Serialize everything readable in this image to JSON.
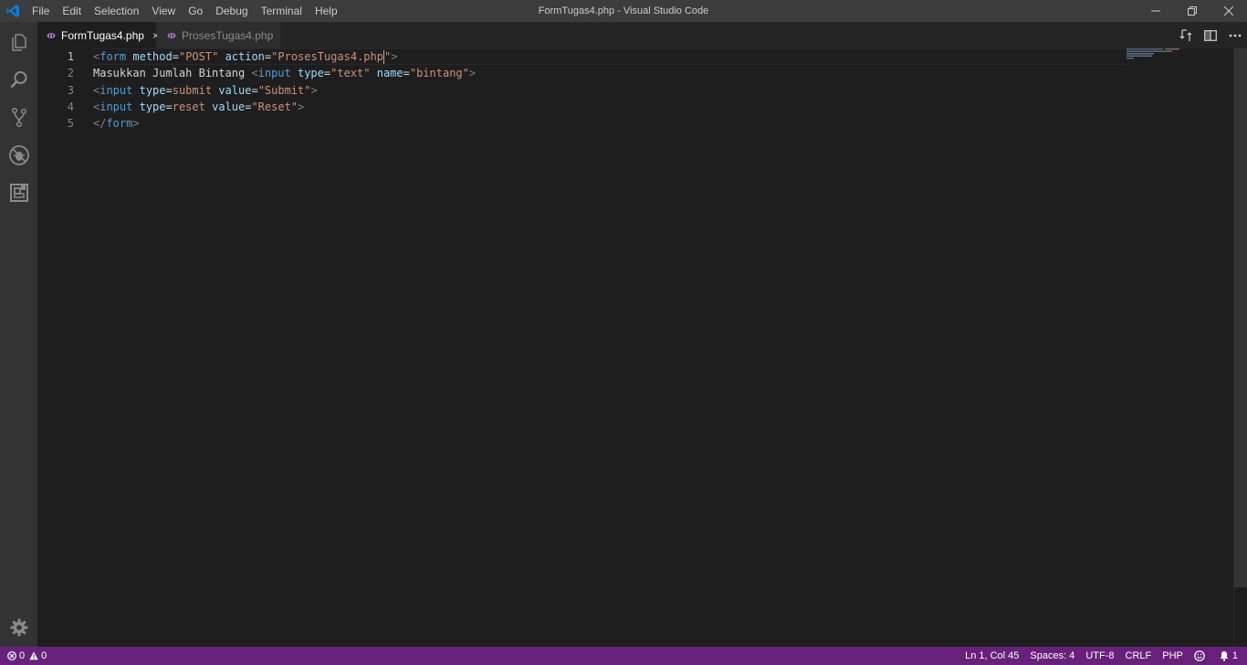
{
  "window": {
    "title": "FormTugas4.php - Visual Studio Code"
  },
  "menu": [
    "File",
    "Edit",
    "Selection",
    "View",
    "Go",
    "Debug",
    "Terminal",
    "Help"
  ],
  "activity_bar": {
    "icons": [
      "explorer-icon",
      "search-icon",
      "source-control-icon",
      "debug-icon",
      "extensions-icon",
      "gear-icon"
    ]
  },
  "tabs": [
    {
      "label": "FormTugas4.php",
      "active": true,
      "close": "×"
    },
    {
      "label": "ProsesTugas4.php",
      "active": false
    }
  ],
  "editor": {
    "line_numbers": [
      "1",
      "2",
      "3",
      "4",
      "5"
    ],
    "lines": [
      [
        {
          "t": "punc",
          "v": "<"
        },
        {
          "t": "tag",
          "v": "form"
        },
        {
          "t": "text",
          "v": " "
        },
        {
          "t": "attr",
          "v": "method"
        },
        {
          "t": "text",
          "v": "="
        },
        {
          "t": "str",
          "v": "\"POST\""
        },
        {
          "t": "text",
          "v": " "
        },
        {
          "t": "attr",
          "v": "action"
        },
        {
          "t": "text",
          "v": "="
        },
        {
          "t": "str",
          "v": "\"ProsesTugas4.php"
        },
        {
          "t": "cursor",
          "v": ""
        },
        {
          "t": "str",
          "v": "\""
        },
        {
          "t": "punc",
          "v": ">"
        }
      ],
      [
        {
          "t": "text",
          "v": "Masukkan Jumlah Bintang "
        },
        {
          "t": "punc",
          "v": "<"
        },
        {
          "t": "tag",
          "v": "input"
        },
        {
          "t": "text",
          "v": " "
        },
        {
          "t": "attr",
          "v": "type"
        },
        {
          "t": "text",
          "v": "="
        },
        {
          "t": "str",
          "v": "\"text\""
        },
        {
          "t": "text",
          "v": " "
        },
        {
          "t": "attr",
          "v": "name"
        },
        {
          "t": "text",
          "v": "="
        },
        {
          "t": "str",
          "v": "\"bintang\""
        },
        {
          "t": "punc",
          "v": ">"
        }
      ],
      [
        {
          "t": "punc",
          "v": "<"
        },
        {
          "t": "tag",
          "v": "input"
        },
        {
          "t": "text",
          "v": " "
        },
        {
          "t": "attr",
          "v": "type"
        },
        {
          "t": "text",
          "v": "="
        },
        {
          "t": "str",
          "v": "submit"
        },
        {
          "t": "text",
          "v": " "
        },
        {
          "t": "attr",
          "v": "value"
        },
        {
          "t": "text",
          "v": "="
        },
        {
          "t": "str",
          "v": "\"Submit\""
        },
        {
          "t": "punc",
          "v": ">"
        }
      ],
      [
        {
          "t": "punc",
          "v": "<"
        },
        {
          "t": "tag",
          "v": "input"
        },
        {
          "t": "text",
          "v": " "
        },
        {
          "t": "attr",
          "v": "type"
        },
        {
          "t": "text",
          "v": "="
        },
        {
          "t": "str",
          "v": "reset"
        },
        {
          "t": "text",
          "v": " "
        },
        {
          "t": "attr",
          "v": "value"
        },
        {
          "t": "text",
          "v": "="
        },
        {
          "t": "str",
          "v": "\"Reset\""
        },
        {
          "t": "punc",
          "v": ">"
        }
      ],
      [
        {
          "t": "punc",
          "v": "</"
        },
        {
          "t": "tag",
          "v": "form"
        },
        {
          "t": "punc",
          "v": ">"
        }
      ]
    ]
  },
  "status": {
    "errors": "0",
    "warnings": "0",
    "position": "Ln 1, Col 45",
    "spaces": "Spaces: 4",
    "encoding": "UTF-8",
    "eol": "CRLF",
    "language": "PHP",
    "notifications": "1"
  },
  "colors": {
    "status_bar": "#68217a",
    "activity_bar": "#333333",
    "title_bar": "#3c3c3c",
    "editor_bg": "#1e1e1e",
    "vscode_blue": "#0e7ad3",
    "php_purple": "#a074c4"
  }
}
